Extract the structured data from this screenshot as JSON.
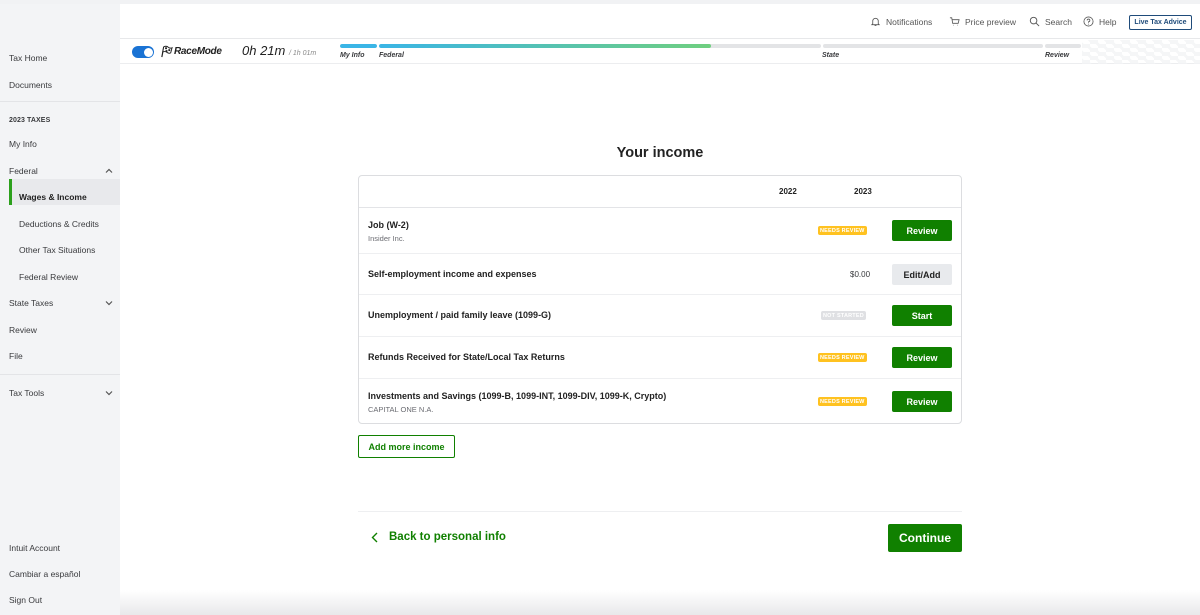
{
  "sidebar": {
    "top_items": [
      {
        "label": "Tax Home"
      },
      {
        "label": "Documents"
      }
    ],
    "section_heading": "2023 TAXES",
    "items": [
      {
        "label": "My Info"
      },
      {
        "label": "Federal",
        "expanded": true
      },
      {
        "label": "Wages & Income",
        "active": true
      },
      {
        "label": "Deductions & Credits"
      },
      {
        "label": "Other Tax Situations"
      },
      {
        "label": "Federal Review"
      },
      {
        "label": "State Taxes",
        "expanded": false
      },
      {
        "label": "Review"
      },
      {
        "label": "File"
      }
    ],
    "tools": {
      "label": "Tax Tools",
      "expanded": false
    },
    "bottom_items": [
      {
        "label": "Intuit Account"
      },
      {
        "label": "Cambiar a español"
      },
      {
        "label": "Sign Out"
      }
    ],
    "active_color": "#2ca01c"
  },
  "header": {
    "notifications": "Notifications",
    "price_preview": "Price preview",
    "search": "Search",
    "help": "Help",
    "live_tax_advice": "Live Tax Advice"
  },
  "racemode": {
    "toggle_on": true,
    "label": "RaceMode",
    "elapsed": "0h 21m",
    "total": "/ 1h 01m",
    "steps": [
      {
        "label": "My Info",
        "progress": 1.0
      },
      {
        "label": "Federal",
        "progress": 0.75
      },
      {
        "label": "State",
        "progress": 0
      },
      {
        "label": "Review",
        "progress": 0
      }
    ]
  },
  "main": {
    "title": "Your income",
    "columns": [
      "2022",
      "2023"
    ],
    "rows": [
      {
        "title": "Job (W-2)",
        "subtitle": "Insider Inc.",
        "badge": "NEEDS REVIEW",
        "badge_type": "review",
        "amount": "",
        "action": "Review",
        "action_style": "primary"
      },
      {
        "title": "Self-employment income and expenses",
        "subtitle": "",
        "badge": "",
        "badge_type": "",
        "amount": "$0.00",
        "action": "Edit/Add",
        "action_style": "secondary"
      },
      {
        "title": "Unemployment / paid family leave (1099-G)",
        "subtitle": "",
        "badge": "NOT STARTED",
        "badge_type": "notstarted",
        "amount": "",
        "action": "Start",
        "action_style": "primary"
      },
      {
        "title": "Refunds Received for State/Local Tax Returns",
        "subtitle": "",
        "badge": "NEEDS REVIEW",
        "badge_type": "review",
        "amount": "",
        "action": "Review",
        "action_style": "primary"
      },
      {
        "title": "Investments and Savings (1099-B, 1099-INT, 1099-DIV, 1099-K, Crypto)",
        "subtitle": "CAPITAL ONE N.A.",
        "badge": "NEEDS REVIEW",
        "badge_type": "review",
        "amount": "",
        "action": "Review",
        "action_style": "primary"
      }
    ],
    "add_more": "Add more income",
    "back_link": "Back to personal info",
    "continue": "Continue"
  },
  "colors": {
    "primary_green": "#108000",
    "badge_yellow": "#ffc220",
    "badge_gray": "#dfe0e3",
    "toggle_blue": "#1a73d4",
    "progress_start": "#3ab5e6",
    "progress_end": "#6fcf7f"
  }
}
